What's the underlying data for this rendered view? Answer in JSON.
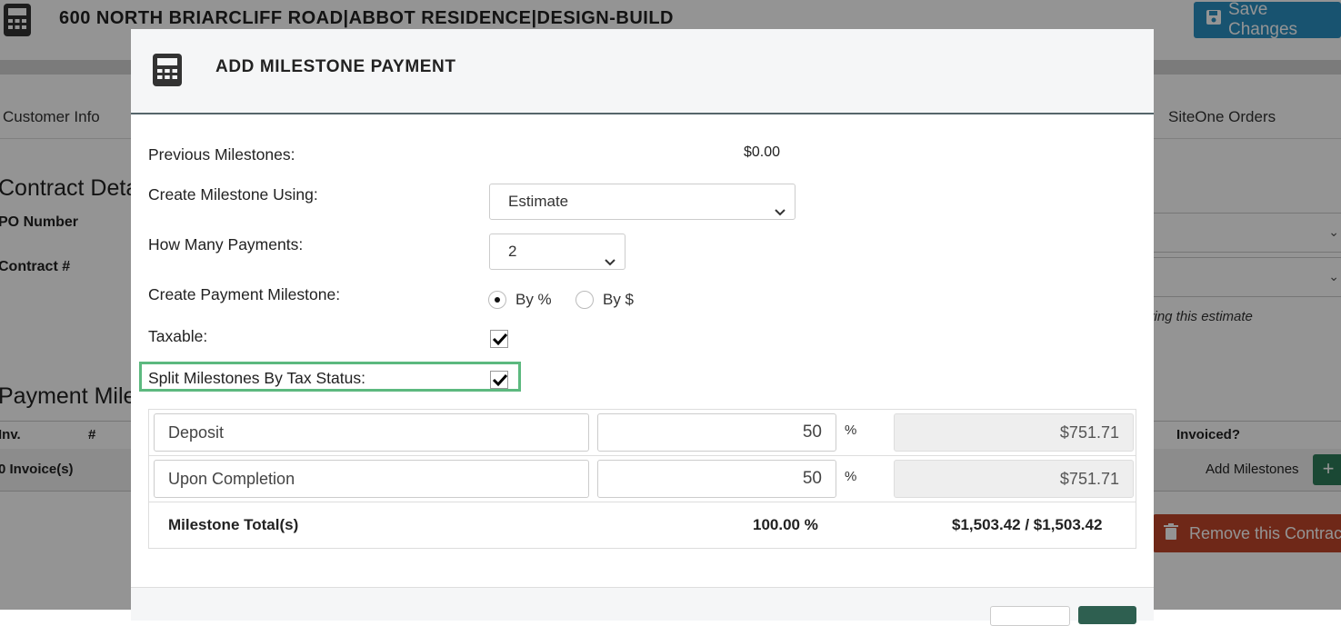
{
  "header": {
    "project_title": "600 NORTH BRIARCLIFF ROAD|ABBOT RESIDENCE|DESIGN-BUILD",
    "save_label": "Save Changes"
  },
  "tabs": {
    "left": "Customer Info",
    "right": "SiteOne Orders"
  },
  "contract": {
    "heading": "Contract Deta",
    "po_label": "PO Number",
    "contract_label": "Contract #",
    "note": "ving this estimate"
  },
  "payments": {
    "heading": "Payment Miles",
    "col_inv": "Inv.",
    "col_num": "#",
    "col_invoiced": "Invoiced?",
    "row_invoices": "0 Invoice(s)",
    "add_milestones": "Add Milestones",
    "plus": "+",
    "remove_label": "Remove this Contract"
  },
  "modal": {
    "title": "ADD MILESTONE PAYMENT",
    "previous_label": "Previous Milestones:",
    "previous_value": "$0.00",
    "create_using_label": "Create Milestone Using:",
    "create_using_value": "Estimate",
    "how_many_label": "How Many Payments:",
    "how_many_value": "2",
    "create_payment_label": "Create Payment Milestone:",
    "radio_pct": "By %",
    "radio_dollar": "By $",
    "selected_radio": "By %",
    "taxable_label": "Taxable:",
    "taxable_checked": true,
    "split_label": "Split Milestones By Tax Status:",
    "split_checked": true,
    "milestones": [
      {
        "name": "Deposit",
        "percent": "50",
        "symbol": "%",
        "amount": "$751.71"
      },
      {
        "name": "Upon Completion",
        "percent": "50",
        "symbol": "%",
        "amount": "$751.71"
      }
    ],
    "total_label": "Milestone Total(s)",
    "total_percent": "100.00 %",
    "total_amount": "$1,503.42 / $1,503.42"
  },
  "colors": {
    "save_button": "#2a8fc1",
    "remove_button": "#c0462a",
    "add_button": "#2e7d5b",
    "highlight_box": "#5cb97f"
  }
}
